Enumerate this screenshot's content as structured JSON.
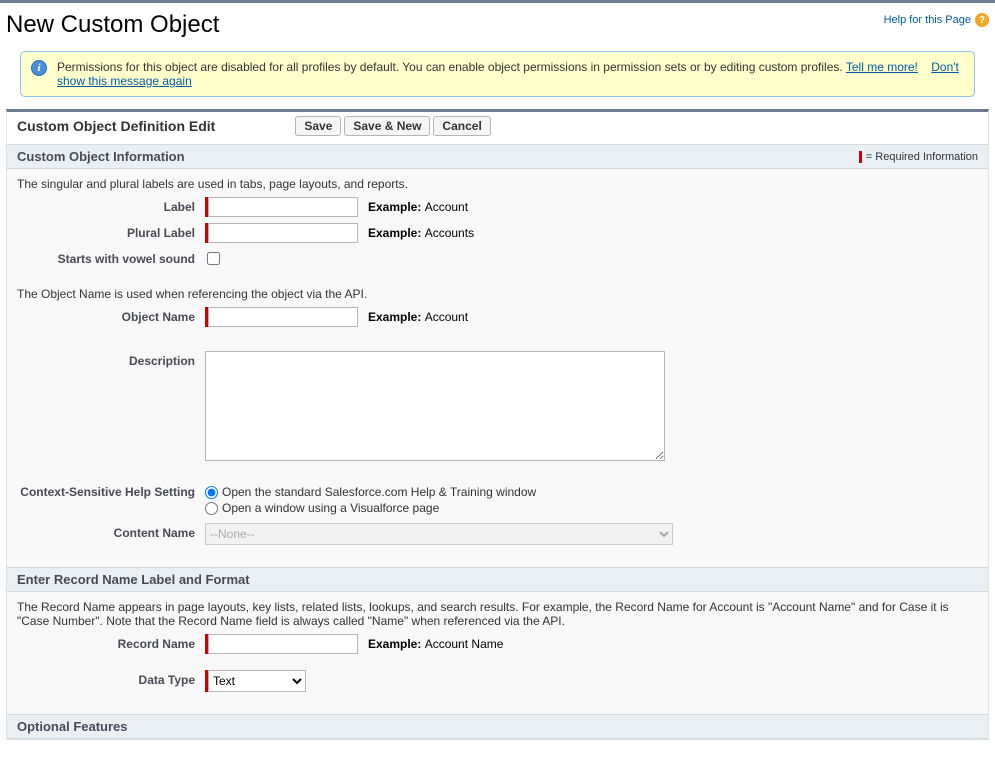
{
  "header": {
    "page_title": "New Custom Object",
    "help_link_text": "Help for this Page"
  },
  "notice": {
    "text": "Permissions for this object are disabled for all profiles by default. You can enable object permissions in permission sets or by editing custom profiles.  ",
    "link_tell_me_more": "Tell me more!",
    "link_dont_show": "Don't show this message again"
  },
  "edit_header": {
    "title": "Custom Object Definition Edit",
    "btn_save": "Save",
    "btn_save_new": "Save & New",
    "btn_cancel": "Cancel"
  },
  "section_info": {
    "title": "Custom Object Information",
    "required_text": "= Required Information",
    "note_labels": "The singular and plural labels are used in tabs, page layouts, and reports.",
    "label_label": "Label",
    "example_label_prefix": "Example:  ",
    "example_label_value": "Account",
    "label_plural": "Plural Label",
    "example_plural_value": "Accounts",
    "label_vowel": "Starts with vowel sound",
    "note_api": "The Object Name is used when referencing the object via the API.",
    "label_object_name": "Object Name",
    "example_object_name_value": "Account",
    "label_description": "Description",
    "label_help_setting": "Context-Sensitive Help Setting",
    "radio_standard": "Open the standard Salesforce.com Help & Training window",
    "radio_vf": "Open a window using a Visualforce page",
    "label_content_name": "Content Name",
    "content_name_value": "--None--"
  },
  "section_record": {
    "title": "Enter Record Name Label and Format",
    "note": "The Record Name appears in page layouts, key lists, related lists, lookups, and search results. For example, the Record Name for Account is \"Account Name\" and for Case it is \"Case Number\". Note that the Record Name field is always called \"Name\" when referenced via the API.",
    "label_record_name": "Record Name",
    "example_record_name_value": "Account Name",
    "label_data_type": "Data Type",
    "data_type_value": "Text"
  },
  "section_optional": {
    "title": "Optional Features"
  }
}
